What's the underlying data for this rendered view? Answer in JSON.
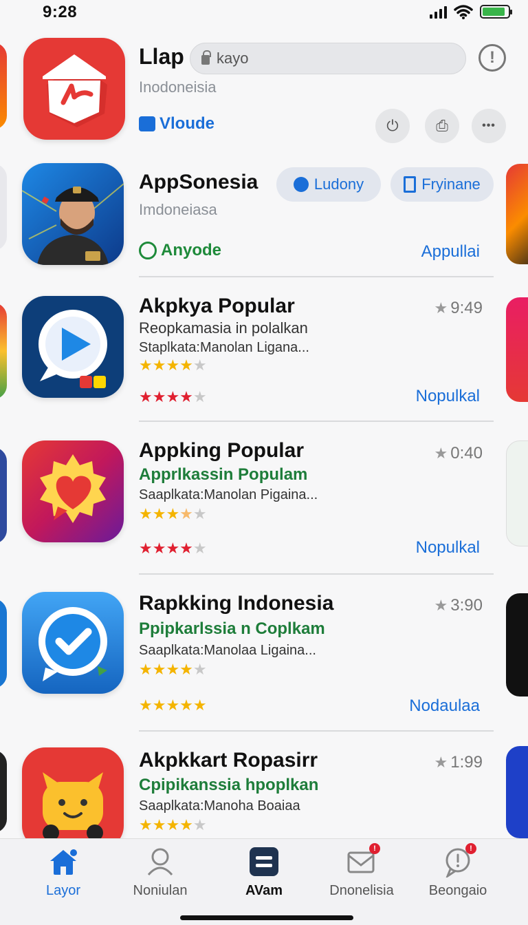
{
  "status_bar": {
    "time": "9:28"
  },
  "header": {
    "title": "Llap",
    "search_value": "kayo",
    "info_label": "!",
    "region": "Inodoneisia",
    "brand_link": "Vloude",
    "action_power": "⏻",
    "action_share": "⎙",
    "action_more": "•••"
  },
  "featured": {
    "title": "AppSonesia",
    "region": "Imdoneiasa",
    "pill_1": "Ludony",
    "pill_2": "Fryinane",
    "brand_link": "Anyode",
    "action_link": "Appullai"
  },
  "list": [
    {
      "title": "Akpkya Popular",
      "rating": "9:49",
      "subtitle": "Reopkamasia in polalkan",
      "description": "Staplkata:Manolan Ligana...",
      "yellow_stars": 4,
      "red_stars": 4,
      "link": "Nopulkal"
    },
    {
      "title": "Appking Popular",
      "rating": "0:40",
      "subtitle": "Apprlkassin Populam",
      "description": "Saaplkata:Manolan Pigaina...",
      "yellow_stars": 3,
      "red_stars": 4,
      "link": "Nopulkal"
    },
    {
      "title": "Rapkking Indonesia",
      "rating": "3:90",
      "subtitle": "Ppipkarlssia n Coplkam",
      "description": "Saaplkata:Manolaa Ligaina...",
      "yellow_stars": 4,
      "red_stars": 5,
      "link": "Nodaulaa"
    },
    {
      "title": "Akpkkart Ropasirr",
      "rating": "1:99",
      "subtitle": "Cpipikanssia hpoplkan",
      "description": "Saaplkata:Manoha Boaiaa",
      "yellow_stars": 4
    }
  ],
  "tabs": [
    {
      "label": "Layor"
    },
    {
      "label": "Noniulan"
    },
    {
      "label": "AVam"
    },
    {
      "label": "Dnonelisia"
    },
    {
      "label": "Beongaio"
    }
  ],
  "colors": {
    "accent": "#1a6ed8",
    "green": "#1e7d3a",
    "star_yellow": "#f4b400",
    "star_red": "#e02030"
  }
}
